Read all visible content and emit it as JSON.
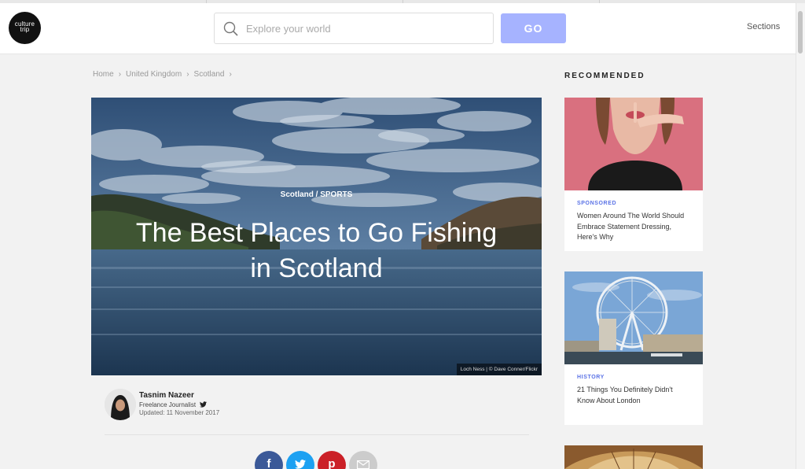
{
  "header": {
    "logo_text_top": "culture",
    "logo_text_bottom": "trip",
    "search_placeholder": "Explore your world",
    "go_label": "GO",
    "sections_label": "Sections"
  },
  "breadcrumb": {
    "items": [
      "Home",
      "United Kingdom",
      "Scotland"
    ],
    "separator": "›"
  },
  "article": {
    "category": "Scotland / SPORTS",
    "title": "The Best Places to Go Fishing in Scotland",
    "photo_credit": "Loch Ness | © Dave Conner/Flickr",
    "author_name": "Tasnim Nazeer",
    "author_role": "Freelance Journalist",
    "updated": "Updated: 11 November 2017"
  },
  "share": {
    "facebook": "f",
    "twitter": "twitter-icon",
    "pinterest": "p",
    "email": "email-icon"
  },
  "recommended": {
    "heading": "RECOMMENDED",
    "cards": [
      {
        "kicker": "SPONSORED",
        "title": "Women Around The World Should Embrace Statement Dressing, Here's Why"
      },
      {
        "kicker": "HISTORY",
        "title": "21 Things You Definitely Didn't Know About London"
      }
    ]
  },
  "colors": {
    "accent": "#a6b3ff",
    "kicker": "#5a72e6",
    "facebook": "#3b5998",
    "twitter": "#1da1f2",
    "pinterest": "#cb2027",
    "email": "#cccccc"
  }
}
